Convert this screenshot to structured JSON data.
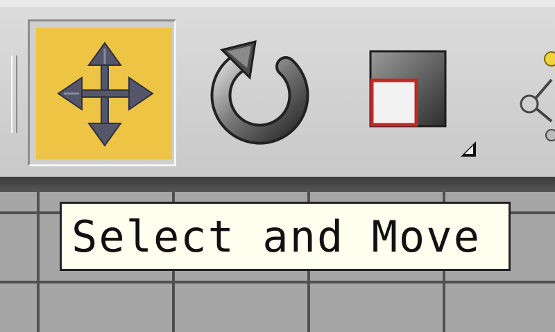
{
  "toolbar": {
    "buttons": [
      {
        "name": "select-and-move",
        "active": true,
        "icon": "move-arrows-icon"
      },
      {
        "name": "select-and-rotate",
        "active": false,
        "icon": "rotate-icon"
      },
      {
        "name": "select-and-scale",
        "active": false,
        "icon": "scale-icon",
        "has_flyout": true
      },
      {
        "name": "partially-visible-tool",
        "active": false,
        "icon": "hierarchy-link-icon"
      }
    ],
    "active_color": "#eec445"
  },
  "tooltip": {
    "text": "Select and Move"
  }
}
